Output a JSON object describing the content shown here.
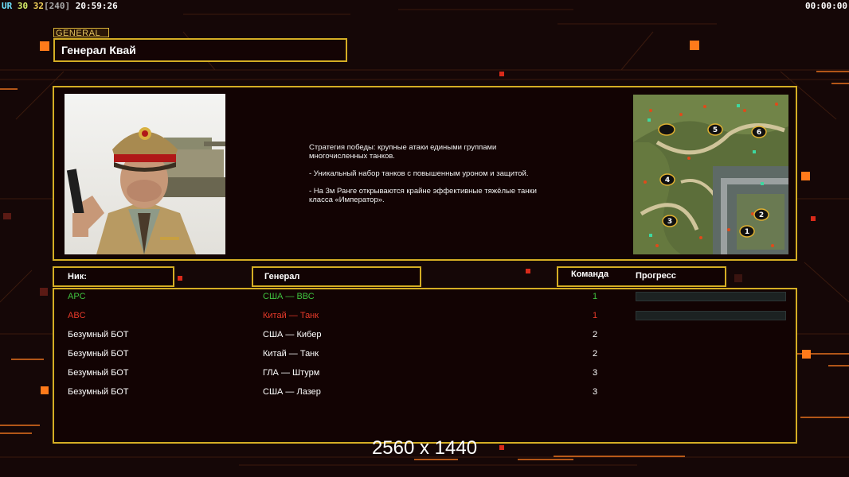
{
  "hud": {
    "ur_label": "UR",
    "fps_a": "30",
    "fps_b": "32",
    "fps_bracket": "[240]",
    "clock": "20:59:26",
    "timer": "00:00:00"
  },
  "general_tag": "GENERAL",
  "general_name": "Генерал Квай",
  "description": "Стратегия победы: крупные атаки едиными группами\n многочисленных танков.\n\n- Уникальный набор танков с повышенным уроном и защитой.\n\n- На 3м Ранге открываются крайне эффективные тяжёлые танки\n класса «Император».",
  "map_markers": [
    "1",
    "2",
    "3",
    "4",
    "5",
    "6"
  ],
  "table": {
    "headers": {
      "nick": "Ник:",
      "general": "Генерал",
      "team": "Команда",
      "progress": "Прогресс"
    },
    "rows": [
      {
        "nick": "APC",
        "general": "США — ВВС",
        "team": "1",
        "color": "#3fc23f",
        "progress": 0
      },
      {
        "nick": "ABC",
        "general": "Китай — Танк",
        "team": "1",
        "color": "#e83a2a",
        "progress": 0
      },
      {
        "nick": "Безумный БОТ",
        "general": "США — Кибер",
        "team": "2",
        "color": "#ffffff"
      },
      {
        "nick": "Безумный БОТ",
        "general": "Китай — Танк",
        "team": "2",
        "color": "#ffffff"
      },
      {
        "nick": "Безумный БОТ",
        "general": "ГЛА — Штурм",
        "team": "3",
        "color": "#ffffff"
      },
      {
        "nick": "Безумный БОТ",
        "general": "США — Лазер",
        "team": "3",
        "color": "#ffffff"
      }
    ]
  },
  "resolution_label": "2560 x 1440",
  "colors": {
    "frame_gold": "#d4ad24",
    "accent_orange": "#ff7a1a",
    "background": "#150707"
  }
}
